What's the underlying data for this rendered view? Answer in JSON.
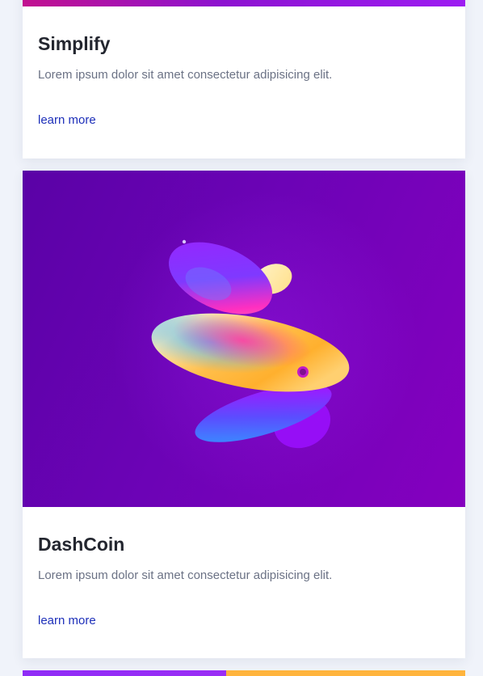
{
  "cards": [
    {
      "title": "Simplify",
      "text": "Lorem ipsum dolor sit amet consectetur adipisicing elit.",
      "link": "learn more"
    },
    {
      "title": "DashCoin",
      "text": "Lorem ipsum dolor sit amet consectetur adipisicing elit.",
      "link": "learn more",
      "image": "abstract-gradient-disc-sculpture"
    }
  ],
  "colors": {
    "page_background": "#f0f3fa",
    "title": "#23262f",
    "body_text": "#6b7285",
    "link": "#1d2fb9",
    "hero_purple": "#6c03b6",
    "accent_orange": "#ffb43d"
  }
}
